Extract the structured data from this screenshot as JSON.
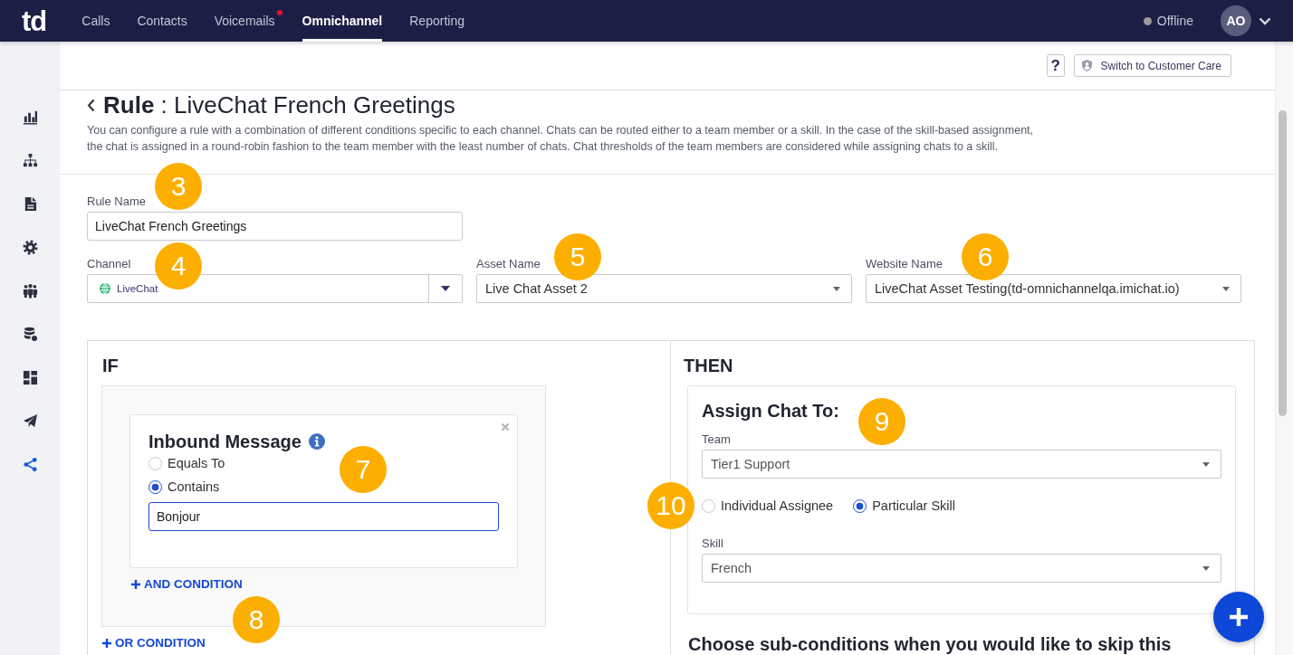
{
  "top_nav": {
    "logo": "td",
    "tabs": [
      {
        "label": "Calls",
        "selected": false,
        "notification": false
      },
      {
        "label": "Contacts",
        "selected": false,
        "notification": false
      },
      {
        "label": "Voicemails",
        "selected": false,
        "notification": true
      },
      {
        "label": "Omnichannel",
        "selected": true,
        "notification": false
      },
      {
        "label": "Reporting",
        "selected": false,
        "notification": false
      }
    ],
    "status": {
      "label": "Offline",
      "online": false
    },
    "avatar": {
      "initials": "AO"
    }
  },
  "sidebar": {
    "items": [
      {
        "selected": false
      },
      {
        "selected": false
      },
      {
        "selected": false
      },
      {
        "selected": false
      },
      {
        "selected": false
      },
      {
        "selected": false
      },
      {
        "selected": false
      },
      {
        "selected": false
      },
      {
        "selected": true
      }
    ]
  },
  "toolbar": {
    "help_button": "?",
    "switch_button": "Switch to Customer Care"
  },
  "header": {
    "title": "**Rule** : LiveChat French Greetings",
    "description": "You can configure a rule with a combination of different conditions specific to each channel. Chats can be routed either to a team member or a skill. In the case of the skill-based assignment, the chat is assigned in a round-robin fashion to the team member with the least number of chats. Chat thresholds of the team members are considered while assigning chats to a skill."
  },
  "form": {
    "rule_name": {
      "label": "Rule Name",
      "value": "LiveChat French Greetings",
      "callout": "3"
    },
    "channel": {
      "label": "Channel",
      "value": "LiveChat",
      "callout": "4"
    },
    "asset_name": {
      "label": "Asset Name",
      "value": "Live Chat Asset 2",
      "callout": "5"
    },
    "website_name": {
      "label": "Website Name",
      "value": "LiveChat Asset Testing(td-omnichannelqa.imichat.io)",
      "callout": "6"
    }
  },
  "if_panel": {
    "heading": "IF",
    "condition": {
      "title": "Inbound Message",
      "options": [
        {
          "label": "Equals To",
          "selected": false
        },
        {
          "label": "Contains",
          "selected": true
        }
      ],
      "value": "Bonjour",
      "focused": true,
      "callout": "7"
    },
    "and_condition": {
      "label": "AND CONDITION",
      "callout": "8"
    },
    "or_condition": "OR CONDITION"
  },
  "then_panel": {
    "heading": "THEN",
    "assign": {
      "title": "Assign Chat To:",
      "callout": "9",
      "team": {
        "label": "Team",
        "value": "Tier1 Support"
      },
      "options": [
        {
          "label": "Individual Assignee",
          "selected": false
        },
        {
          "label": "Particular Skill",
          "selected": true
        }
      ],
      "options_callout": "10",
      "skill": {
        "label": "Skill",
        "value": "French"
      }
    },
    "subconditions_heading": "Choose sub-conditions when you would like to skip this"
  }
}
